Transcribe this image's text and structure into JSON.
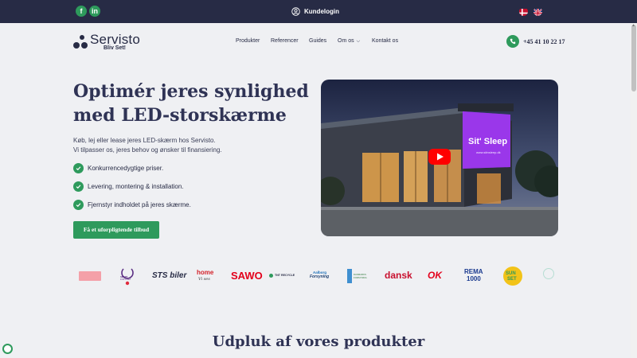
{
  "topbar": {
    "social": [
      {
        "label": "f",
        "icon": "facebook-icon"
      },
      {
        "label": "in",
        "icon": "linkedin-icon"
      }
    ],
    "login_label": "Kundelogin",
    "languages": [
      "da",
      "en"
    ]
  },
  "header": {
    "logo_word": "Servisto",
    "logo_tagline": "Bliv Set!",
    "nav": [
      "Produkter",
      "Referencer",
      "Guides",
      "Om os",
      "Kontakt os"
    ],
    "phone": "+45 41 10 22 17"
  },
  "hero": {
    "title_line1": "Optimér jeres synlighed",
    "title_line2": "med LED-storskærme",
    "subtitle_line1": "Køb, lej eller lease jeres LED-skærm hos Servisto.",
    "subtitle_line2": "Vi tilpasser os, jeres behov og ønsker til finansiering.",
    "checks": [
      "Konkurrencedygtige priser.",
      "Levering, montering & installation.",
      "Fjernstyr indholdet på jeres skærme."
    ],
    "cta_label": "Få et uforpligtende tilbud",
    "video_screen_brand": "Sit' Sleep",
    "video_screen_url": "www.sitnsleep.dk"
  },
  "brands": {
    "sts_main": "STS biler",
    "home_main": "home",
    "home_script": "Vi ses",
    "sawo": "SAWO",
    "tnt": "TNT RECYCLE",
    "aalborg_line1": "Aalborg",
    "aalborg_line2": "Forsyning",
    "danish_line1": "DANMARKS",
    "danish_line2": "FORSYNING",
    "dansk": "dansk",
    "ok": "OK",
    "rema_line1": "REMA",
    "rema_line2": "1000",
    "sunset_line1": "SUN",
    "sunset_line2": "SET",
    "smart_line1": "SMART",
    "smart_line2": "FOR LIVET"
  },
  "section": {
    "title": "Udpluk af vores produkter"
  },
  "colors": {
    "navy": "#272b45",
    "green": "#2e9a5c",
    "page_bg": "#eff0f3"
  }
}
